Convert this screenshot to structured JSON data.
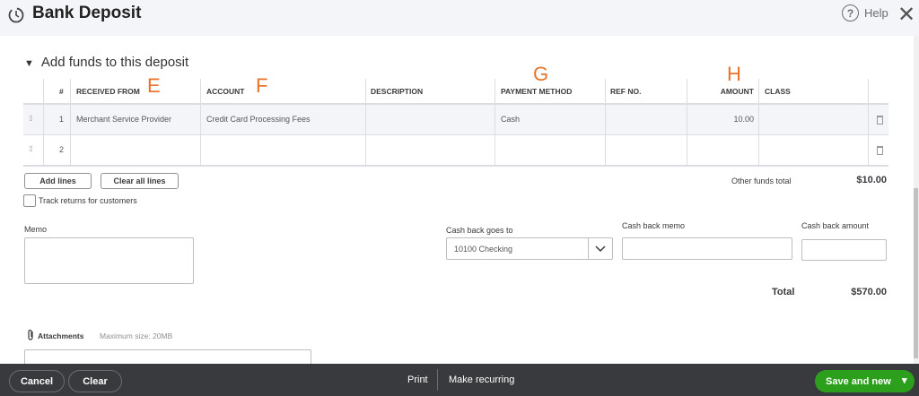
{
  "header": {
    "title": "Bank Deposit",
    "help": "Help",
    "help_icon": "?",
    "close_icon": "✕"
  },
  "section": {
    "toggle": "▼",
    "title": "Add funds to this deposit"
  },
  "annotations": [
    "E",
    "F",
    "G",
    "H"
  ],
  "table": {
    "columns": [
      "#",
      "RECEIVED FROM",
      "ACCOUNT",
      "DESCRIPTION",
      "PAYMENT METHOD",
      "REF NO.",
      "AMOUNT",
      "CLASS"
    ],
    "rows": [
      {
        "num": "1",
        "received_from": "Merchant Service Provider",
        "account": "Credit Card Processing Fees",
        "description": "",
        "payment_method": "Cash",
        "ref_no": "",
        "amount": "10.00",
        "class": ""
      },
      {
        "num": "2",
        "received_from": "",
        "account": "",
        "description": "",
        "payment_method": "",
        "ref_no": "",
        "amount": "",
        "class": ""
      }
    ]
  },
  "buttons": {
    "add_lines": "Add lines",
    "clear_all_lines": "Clear all lines"
  },
  "track_returns": "Track returns for customers",
  "other_funds": {
    "label": "Other funds total",
    "value": "$10.00"
  },
  "memo": {
    "label": "Memo",
    "value": ""
  },
  "cash_back": {
    "goes_to_label": "Cash back goes to",
    "goes_to_value": "10100 Checking",
    "memo_label": "Cash back memo",
    "amount_label": "Cash back amount"
  },
  "total": {
    "label": "Total",
    "value": "$570.00"
  },
  "attachments": {
    "label": "Attachments",
    "max_size": "Maximum size: 20MB"
  },
  "footer": {
    "cancel": "Cancel",
    "clear": "Clear",
    "print": "Print",
    "make_recurring": "Make recurring",
    "save_and_new": "Save and new",
    "dropdown": "▾"
  },
  "colors": {
    "accent": "#2ca01c",
    "annotation": "#e8742b",
    "footer": "#393a3d"
  }
}
